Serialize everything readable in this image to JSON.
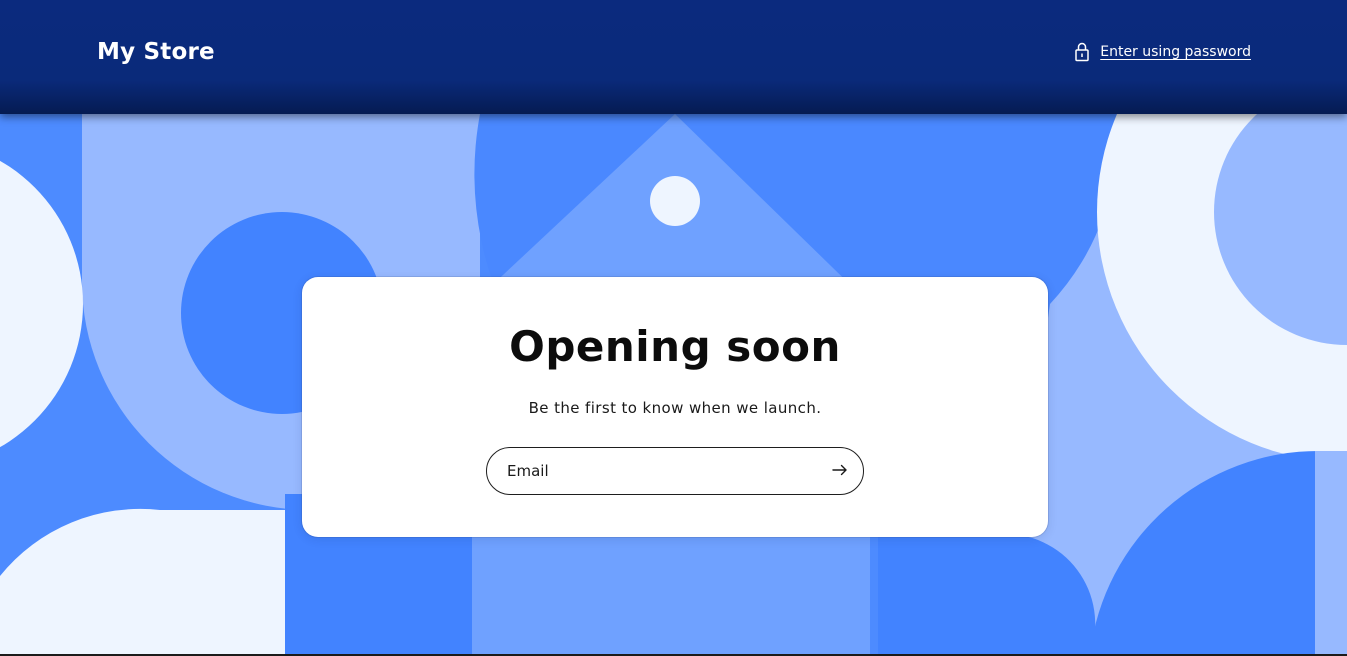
{
  "header": {
    "store_name": "My Store",
    "password_link": "Enter using password",
    "lock_icon": "lock-icon"
  },
  "main": {
    "heading": "Opening soon",
    "subtext": "Be the first to know when we launch.",
    "email": {
      "placeholder": "Email",
      "value": "",
      "submit_icon": "arrow-right-icon"
    }
  },
  "colors": {
    "header_bg": "#0b2a7e",
    "hero_blue": "#4d8bff",
    "hero_light_blue": "#97b9ff",
    "hero_mid_blue": "#6fa1ff",
    "hero_white": "#eef5ff",
    "card_bg": "#ffffff",
    "text_dark": "#0c0c0c"
  }
}
